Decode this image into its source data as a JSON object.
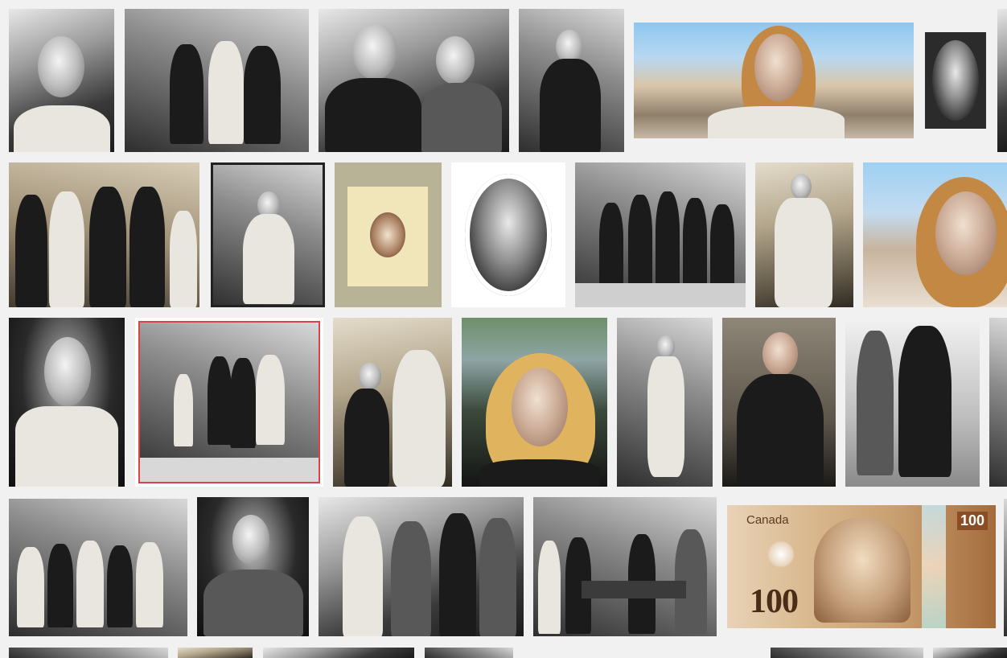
{
  "banknote": {
    "country": "Canada",
    "denomination_large": "100",
    "denomination_small": "100"
  },
  "colors": {
    "page_background": "#f1f1f1",
    "banknote_tone": "#c79d6e"
  }
}
